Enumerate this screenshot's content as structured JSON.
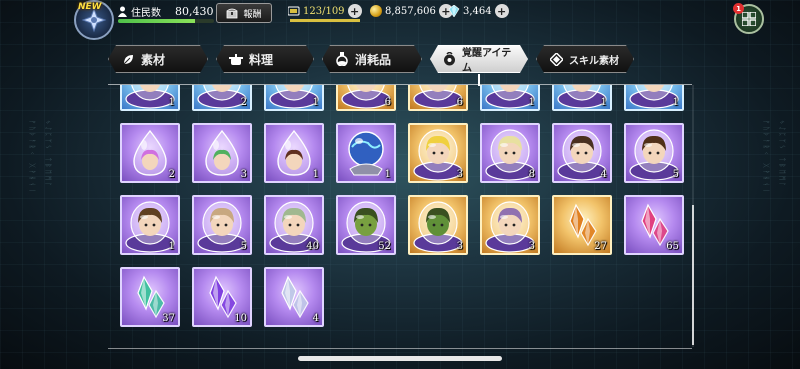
{
  "topbar": {
    "new_badge": "NEW",
    "resident_label": "住民数",
    "resident_value": "80,430",
    "resident_progress": 0.8,
    "reward_label": "報酬",
    "stamina": "123/109",
    "stamina_progress": 1.0,
    "coins": "8,857,606",
    "crystals": "3,464",
    "notification_count": "1"
  },
  "tabs": [
    {
      "label": "素材",
      "icon": "leaf-icon",
      "active": false
    },
    {
      "label": "料理",
      "icon": "pot-icon",
      "active": false
    },
    {
      "label": "消耗品",
      "icon": "potion-icon",
      "active": false
    },
    {
      "label": "覚醒アイテム",
      "icon": "awaken-orb-icon",
      "active": true
    },
    {
      "label": "スキル素材",
      "icon": "diamond-icon",
      "active": false
    }
  ],
  "items": [
    {
      "frame": "blue",
      "kind": "character",
      "hair": "#e8c860",
      "count": "1"
    },
    {
      "frame": "blue",
      "kind": "character",
      "hair": "#3a2a50",
      "count": "2"
    },
    {
      "frame": "blue",
      "kind": "character",
      "hair": "#e87a40",
      "count": "1"
    },
    {
      "frame": "gold",
      "kind": "character",
      "hair": "#b0b0c8",
      "count": "6"
    },
    {
      "frame": "gold",
      "kind": "character",
      "hair": "#a08080",
      "count": "6"
    },
    {
      "frame": "blue",
      "kind": "character",
      "hair": "#80c870",
      "count": "1"
    },
    {
      "frame": "blue",
      "kind": "character",
      "hair": "#202028",
      "count": "1"
    },
    {
      "frame": "blue",
      "kind": "character",
      "hair": "#c0c0d8",
      "count": "1"
    },
    {
      "frame": "purple",
      "kind": "drop",
      "hair": "#d070e0",
      "count": "2"
    },
    {
      "frame": "purple",
      "kind": "drop",
      "hair": "#50b060",
      "count": "3"
    },
    {
      "frame": "purple",
      "kind": "drop",
      "hair": "#603020",
      "count": "1"
    },
    {
      "frame": "purple",
      "kind": "globe",
      "hair": "#3060c0",
      "count": "1"
    },
    {
      "frame": "gold",
      "kind": "character",
      "hair": "#f0d040",
      "count": "3"
    },
    {
      "frame": "purple",
      "kind": "character",
      "hair": "#e8e0a0",
      "count": "8"
    },
    {
      "frame": "purple",
      "kind": "character",
      "hair": "#4a3020",
      "count": "4"
    },
    {
      "frame": "purple",
      "kind": "character",
      "hair": "#503018",
      "count": "5"
    },
    {
      "frame": "purple",
      "kind": "character",
      "hair": "#604020",
      "count": "1"
    },
    {
      "frame": "purple",
      "kind": "character",
      "hair": "#c8a880",
      "count": "5"
    },
    {
      "frame": "purple",
      "kind": "character",
      "hair": "#a0b890",
      "count": "40"
    },
    {
      "frame": "purple",
      "kind": "monster",
      "hair": "#78a040",
      "count": "52"
    },
    {
      "frame": "gold",
      "kind": "monster",
      "hair": "#609038",
      "count": "3"
    },
    {
      "frame": "gold",
      "kind": "character",
      "hair": "#9070b0",
      "count": "3"
    },
    {
      "frame": "gold",
      "kind": "crystal",
      "hair": "#e08020",
      "count": "27"
    },
    {
      "frame": "purple",
      "kind": "crystal",
      "hair": "#e04080",
      "count": "65"
    },
    {
      "frame": "purple",
      "kind": "crystal",
      "hair": "#40c0a0",
      "count": "37"
    },
    {
      "frame": "purple",
      "kind": "crystal",
      "hair": "#8040e0",
      "count": "10"
    },
    {
      "frame": "purple",
      "kind": "crystal",
      "hair": "#c0c8e8",
      "count": "4"
    }
  ],
  "colors": {
    "tab_active_bg": "#f0f0f0",
    "frame_purple": "#b58aef",
    "frame_blue": "#7fc6f0",
    "frame_gold": "#f2c36a"
  }
}
